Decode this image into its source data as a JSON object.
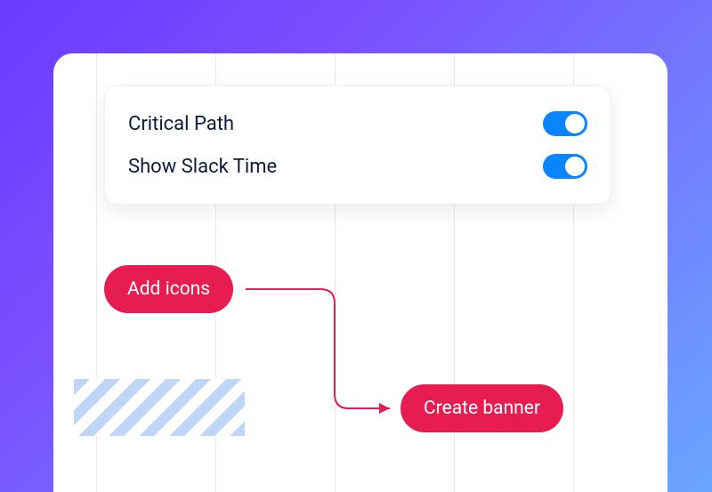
{
  "toggles": {
    "critical_path": {
      "label": "Critical Path",
      "on": true
    },
    "show_slack": {
      "label": "Show Slack Time",
      "on": true
    }
  },
  "tasks": {
    "a": {
      "label": "Add icons"
    },
    "b": {
      "label": "Create banner"
    }
  },
  "colors": {
    "accent": "#e71d52",
    "toggle": "#0a84ff"
  }
}
